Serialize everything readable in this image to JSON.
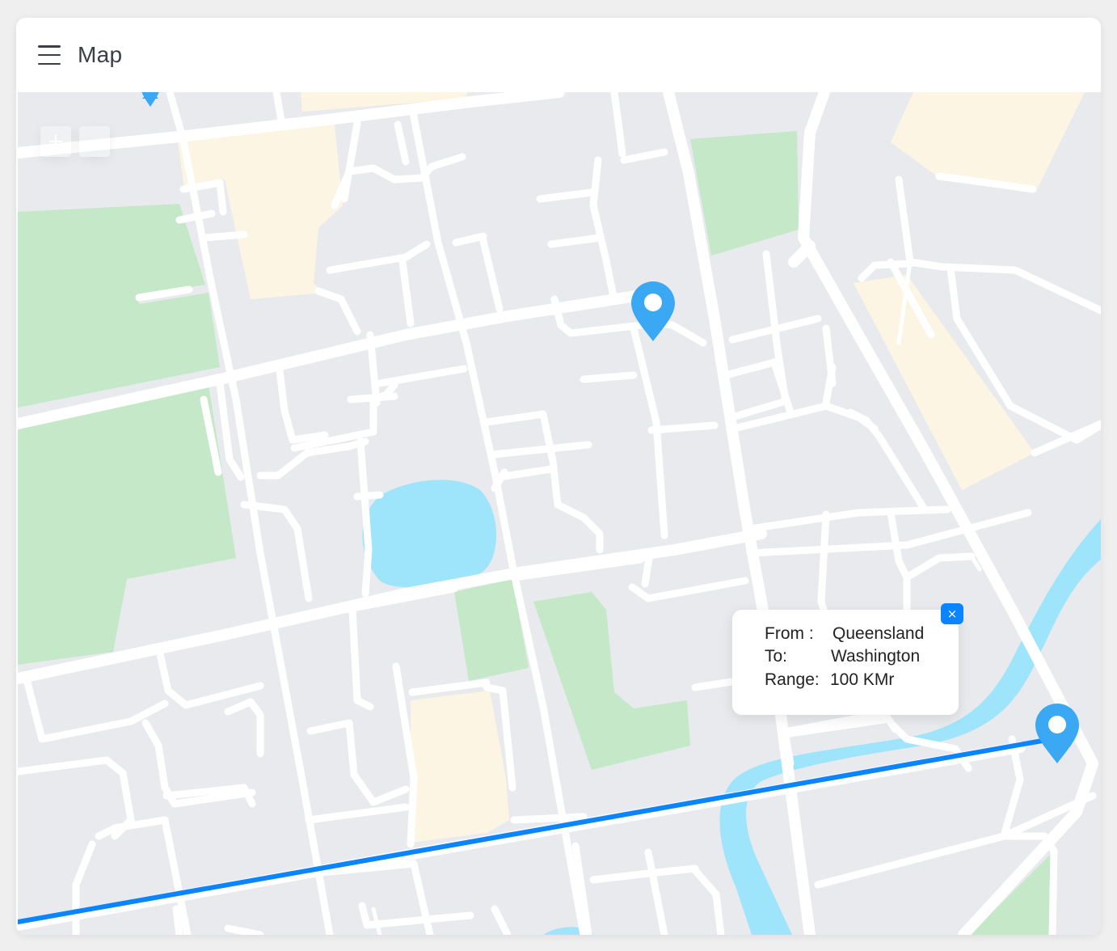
{
  "header": {
    "title": "Map"
  },
  "zoom": {
    "in_label": "+",
    "out_label": "−"
  },
  "popup": {
    "close_label": "×",
    "from_label": "From :",
    "from_value": "Queensland",
    "to_label": "To:",
    "to_value": "Washington",
    "range_label": "Range:",
    "range_value": "100 KMr"
  },
  "markers": [
    {
      "name": "marker-top-left",
      "icon": "map-pin-icon"
    },
    {
      "name": "marker-center",
      "icon": "map-pin-icon"
    },
    {
      "name": "marker-destination",
      "icon": "map-pin-icon"
    }
  ],
  "colors": {
    "background": "#e8eaed",
    "park": "#c5e8c9",
    "building": "#fdf5e4",
    "water": "#9ee5fb",
    "road": "#ffffff",
    "route": "#0a84ff",
    "marker": "#3aa8f2"
  }
}
